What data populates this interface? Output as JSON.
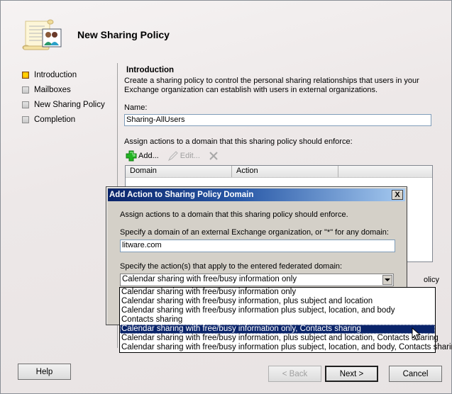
{
  "window": {
    "title": "New Sharing Policy"
  },
  "icons": {
    "header": "policy-scroll-users-icon",
    "add": "green-plus-icon",
    "edit": "pencil-icon",
    "delete": "x-delete-icon",
    "combo": "chevron-down-icon",
    "close": "close-icon"
  },
  "nav": {
    "items": [
      {
        "label": "Introduction",
        "active": true
      },
      {
        "label": "Mailboxes",
        "active": false
      },
      {
        "label": "New Sharing Policy",
        "active": false
      },
      {
        "label": "Completion",
        "active": false
      }
    ]
  },
  "content": {
    "section_title": "Introduction",
    "description": "Create a sharing policy to control the personal sharing relationships that users in your Exchange organization can establish with users in external organizations.",
    "name_label": "Name:",
    "name_value": "Sharing-AllUsers",
    "assign_label": "Assign actions to a domain that this sharing policy should enforce:",
    "toolbar": {
      "add_label": "Add...",
      "edit_label": "Edit..."
    },
    "table": {
      "columns": [
        "Domain",
        "Action",
        ""
      ]
    },
    "partial_text": "olicy"
  },
  "footer": {
    "help_label": "Help",
    "back_label": "< Back",
    "next_label": "Next >",
    "cancel_label": "Cancel"
  },
  "dialog": {
    "title": "Add Action to Sharing Policy Domain",
    "close_label": "X",
    "intro": "Assign actions to a domain that this sharing policy should enforce.",
    "domain_label": "Specify a domain of an external Exchange organization, or \"*\" for any domain:",
    "domain_value": "litware.com",
    "action_label": "Specify the action(s) that apply to the entered federated domain:",
    "action_selected": "Calendar sharing with free/busy information only",
    "action_options": [
      "Calendar sharing with free/busy information only",
      "Calendar sharing with free/busy information, plus subject and location",
      "Calendar sharing with free/busy information plus subject, location, and body",
      "Contacts sharing",
      "Calendar sharing with free/busy information only, Contacts sharing",
      "Calendar sharing with free/busy information, plus subject and location, Contacts sharing",
      "Calendar sharing with free/busy information plus subject, location, and body, Contacts sharing"
    ],
    "highlighted_option_index": 4
  },
  "colors": {
    "title_bar_start": "#0a246a",
    "title_bar_end": "#a6caf0",
    "selection": "#0a246a",
    "add_icon": "#22b422"
  }
}
